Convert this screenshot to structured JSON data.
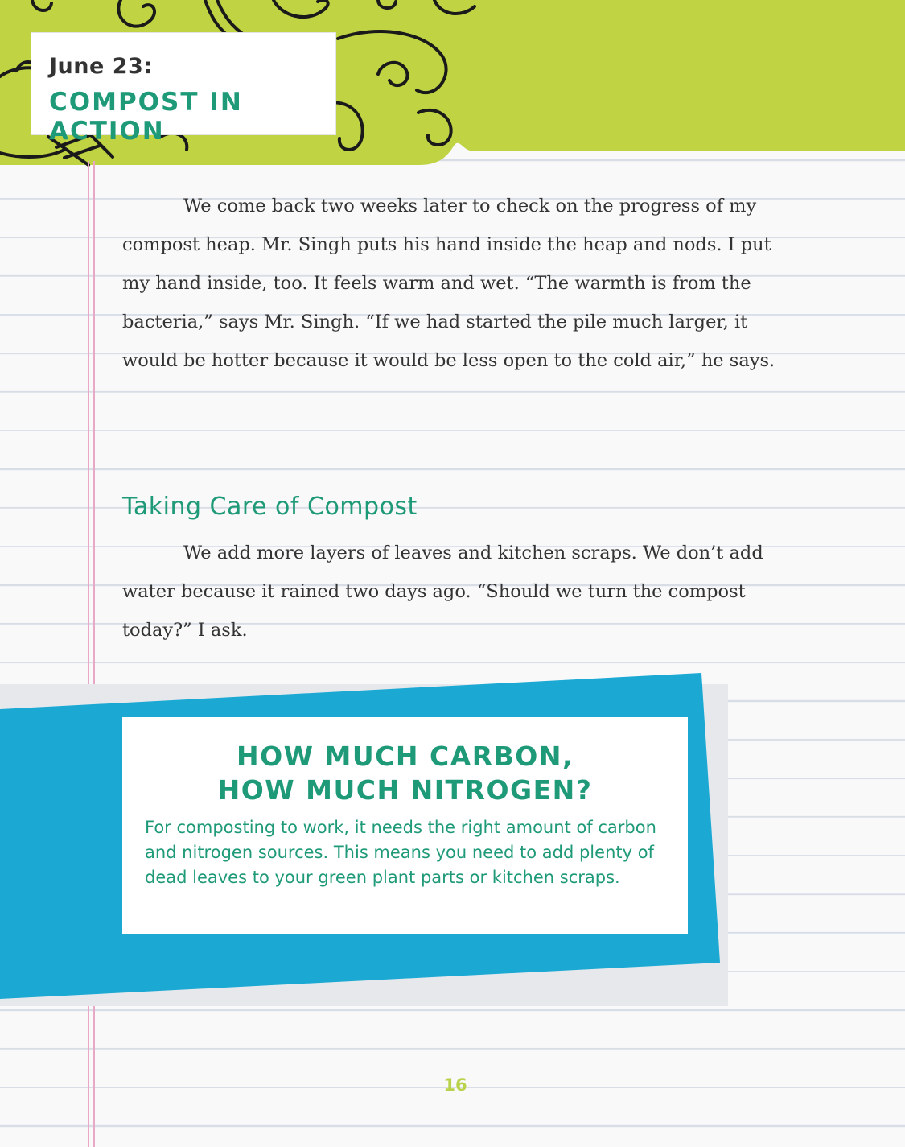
{
  "header": {
    "date": "June 23:",
    "title": "COMPOST IN ACTION"
  },
  "body": {
    "paragraph_1": "We come back two weeks later to check on the progress of my compost heap. Mr. Singh puts his hand inside the heap and nods. I put my hand inside, too. It feels warm and wet. “The warmth is from the bacteria,” says Mr. Singh. “If we had started the pile much larger, it would be hotter because it would be less open to the cold air,” he says.",
    "subheading": "Taking Care of Compost",
    "paragraph_2": "We add more layers of leaves and kitchen scraps. We don’t add water because it rained two days ago. “Should we turn the compost today?” I ask."
  },
  "sidebar": {
    "title_line_1": "HOW MUCH CARBON,",
    "title_line_2": "HOW MUCH NITROGEN?",
    "text": "For composting to work, it needs the right amount of carbon and nitrogen sources. This means you need to add plenty of dead leaves to your green plant parts or kitchen scraps."
  },
  "footer": {
    "page_number": "16"
  },
  "colors": {
    "header_green": "#c0d343",
    "sidebar_blue": "#1ba9d4",
    "heading_teal": "#1f9a78",
    "margin_pink": "#e9a8c6",
    "page_number": "#b8d24a"
  }
}
